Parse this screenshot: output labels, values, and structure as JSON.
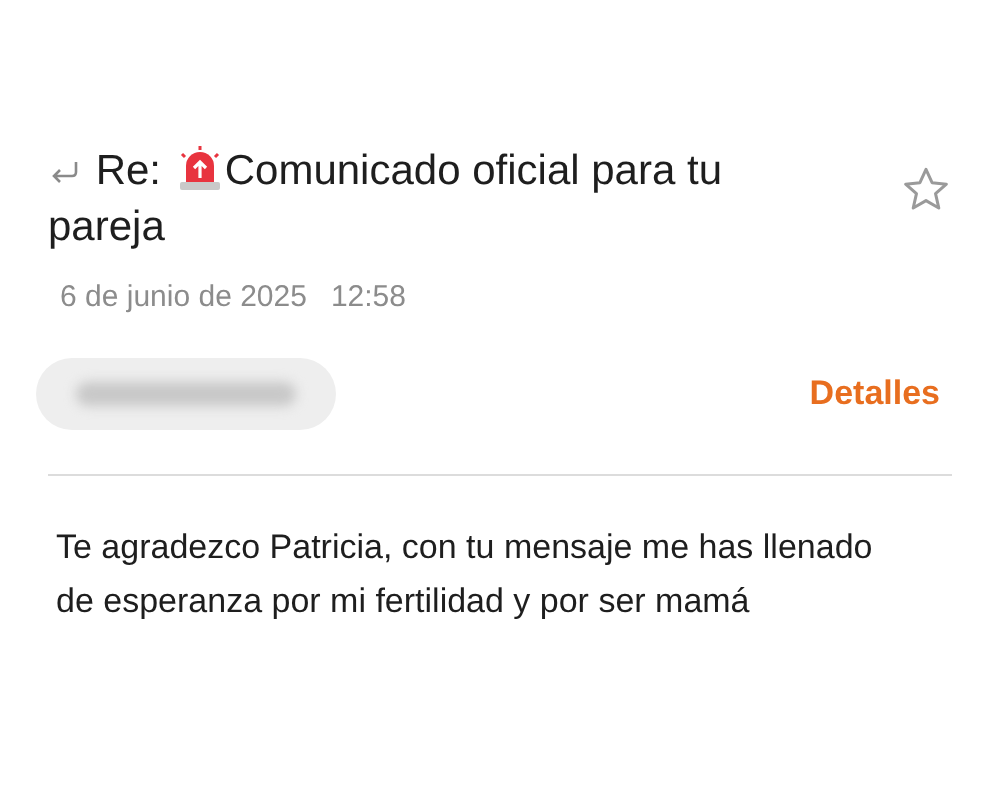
{
  "email": {
    "subject_prefix": "Re:",
    "subject": "Comunicado oficial para tu pareja",
    "starred": false,
    "date": "6 de junio de 2025",
    "time": "12:58"
  },
  "sender": {
    "details_link": "Detalles"
  },
  "body": "Te agradezco Patricia, con tu mensaje me has llenado de esperanza por mi fertilidad y por ser mamá"
}
